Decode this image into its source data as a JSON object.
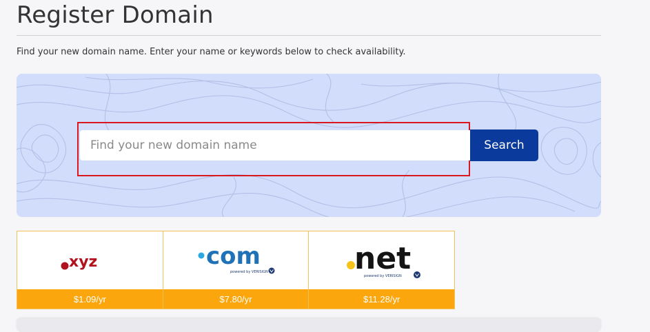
{
  "header": {
    "title": "Register Domain",
    "intro": "Find your new domain name. Enter your name or keywords below to check availability."
  },
  "search": {
    "placeholder": "Find your new domain name",
    "value": "",
    "button_label": "Search"
  },
  "tlds": [
    {
      "name": "xyz",
      "logo_text": "xyz",
      "price": "$1.09/yr"
    },
    {
      "name": "com",
      "logo_text": "com",
      "powered_by": "powered by VERISIGN",
      "price": "$7.80/yr"
    },
    {
      "name": "net",
      "logo_text": "net",
      "powered_by": "powered by VERISIGN",
      "price": "$11.28/yr"
    }
  ],
  "colors": {
    "panel_bg": "#d2dcfb",
    "search_button": "#0a3a9b",
    "price_bar": "#fca60d",
    "highlight": "#d9171e"
  }
}
